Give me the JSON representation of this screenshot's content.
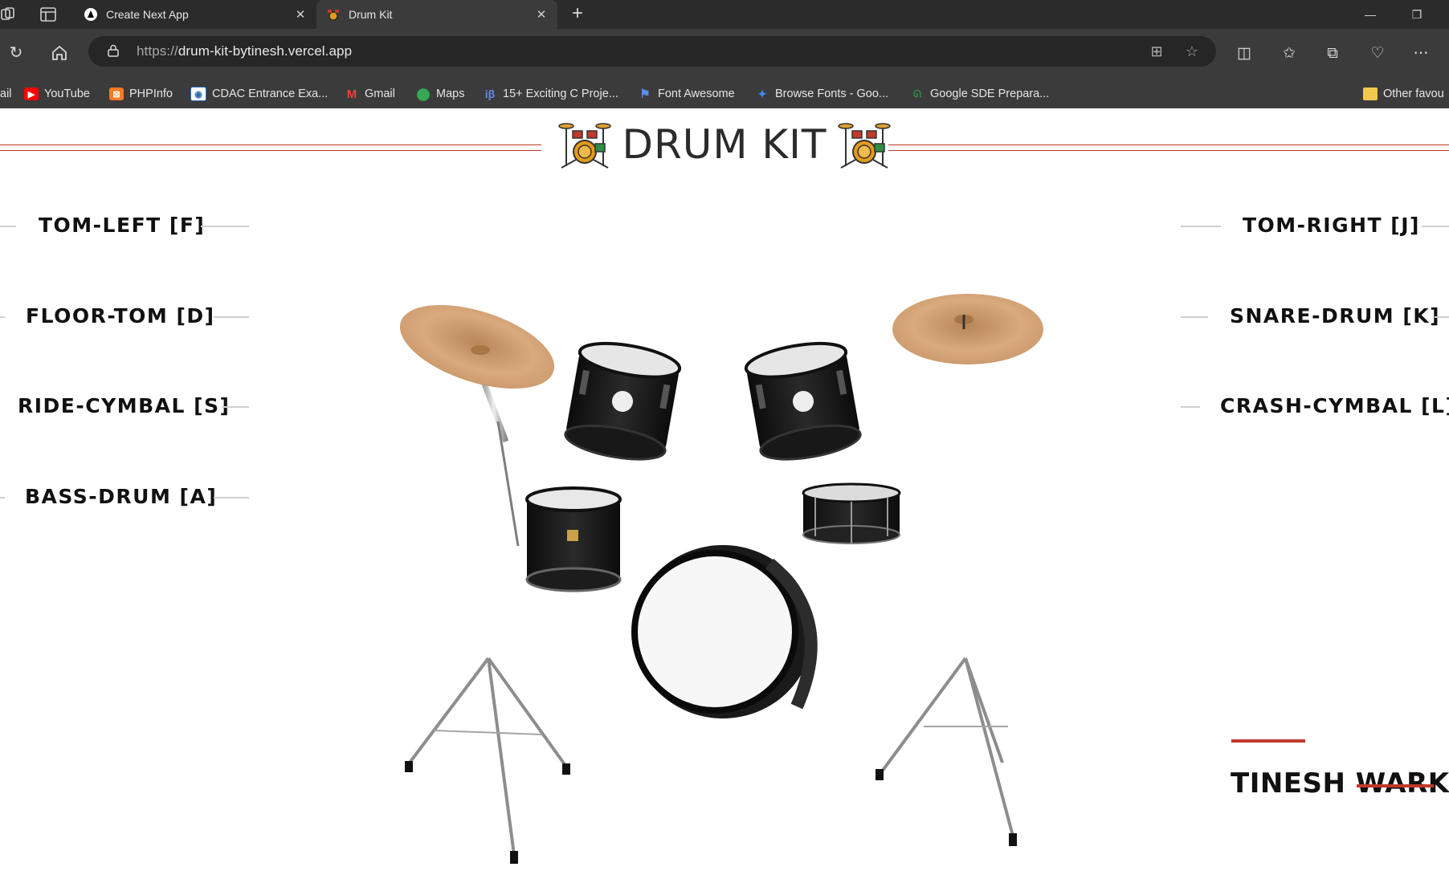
{
  "browser": {
    "tabs": [
      {
        "title": "Create Next App",
        "active": false,
        "icon": "nextjs-icon"
      },
      {
        "title": "Drum Kit",
        "active": true,
        "icon": "drum-kit-favicon"
      }
    ],
    "url_prefix": "https://",
    "url_host": "drum-kit-bytinesh.vercel.app",
    "bookmarks": [
      {
        "label": "ail",
        "icon": "mail-icon"
      },
      {
        "label": "YouTube",
        "icon": "youtube-icon",
        "color": "#ff0000"
      },
      {
        "label": "PHPInfo",
        "icon": "xampp-icon",
        "color": "#fb7a24"
      },
      {
        "label": "CDAC Entrance Exa...",
        "icon": "cdac-icon",
        "color": "#2a6db3"
      },
      {
        "label": "Gmail",
        "icon": "gmail-icon",
        "color": "#ea4335"
      },
      {
        "label": "Maps",
        "icon": "maps-icon",
        "color": "#34a853"
      },
      {
        "label": "15+ Exciting C Proje...",
        "icon": "ib-icon",
        "color": "#5b8def"
      },
      {
        "label": "Font Awesome",
        "icon": "flag-icon",
        "color": "#5a8dee"
      },
      {
        "label": "Browse Fonts - Goo...",
        "icon": "google-fonts-icon",
        "color": "#4285f4"
      },
      {
        "label": "Google SDE Prepara...",
        "icon": "gfg-icon",
        "color": "#2f8d46"
      },
      {
        "label": "Other favou",
        "icon": "folder-icon",
        "color": "#f2c94c"
      }
    ]
  },
  "page": {
    "title": "DRUM KIT",
    "left_keys": [
      "TOM-LEFT [F]",
      "FLOOR-TOM [D]",
      "RIDE-CYMBAL [S]",
      "BASS-DRUM [A]"
    ],
    "right_keys": [
      "TOM-RIGHT [J]",
      "SNARE-DRUM [K]",
      "CRASH-CYMBAL [L]"
    ],
    "signature": "TINESH WARKE",
    "accent_color": "#c0392b"
  }
}
